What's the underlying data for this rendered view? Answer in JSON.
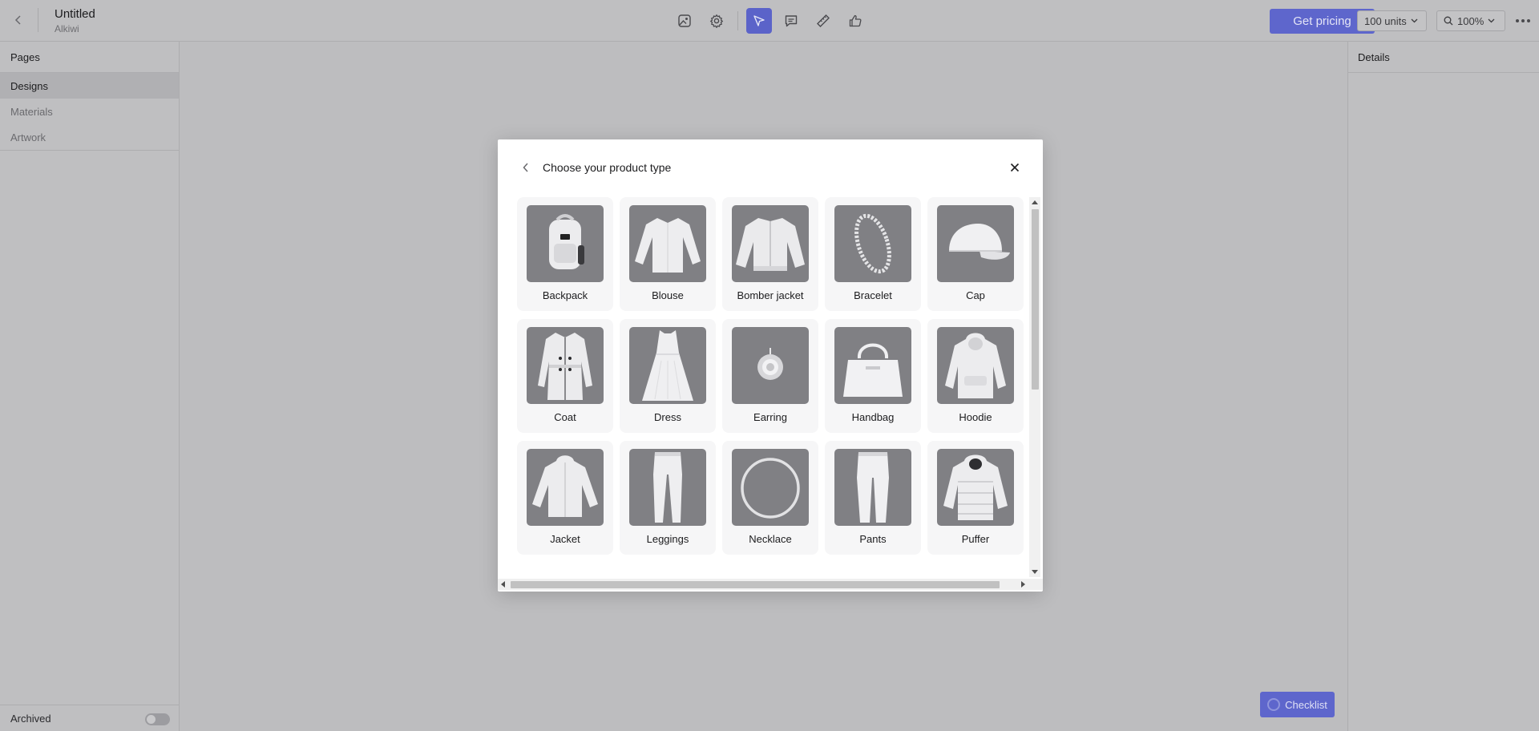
{
  "header": {
    "title": "Untitled",
    "subtitle": "Alkiwi",
    "back_icon": "chevron-left-icon",
    "tools": [
      {
        "name": "image-tool",
        "icon": "image-icon",
        "active": false
      },
      {
        "name": "settings-tool",
        "icon": "gear-icon",
        "active": false
      },
      {
        "name": "select-tool",
        "icon": "cursor-arrow-icon",
        "active": true
      },
      {
        "name": "comment-tool",
        "icon": "comment-icon",
        "active": false
      },
      {
        "name": "measure-tool",
        "icon": "ruler-icon",
        "active": false
      },
      {
        "name": "approve-tool",
        "icon": "thumbs-up-icon",
        "active": false
      }
    ],
    "pricing_label": "Get pricing",
    "units_label": "100 units",
    "zoom_label": "100%",
    "more_icon": "more-horizontal-icon"
  },
  "left_panel": {
    "heading": "Pages",
    "items": [
      {
        "label": "Designs",
        "active": true
      },
      {
        "label": "Materials",
        "active": false
      },
      {
        "label": "Artwork",
        "active": false
      }
    ],
    "archived_label": "Archived",
    "archived_on": false
  },
  "right_panel": {
    "heading": "Details"
  },
  "checklist_label": "Checklist",
  "modal": {
    "title": "Choose your product type",
    "back_icon": "chevron-left-icon",
    "close_icon": "close-icon",
    "products": [
      {
        "label": "Backpack",
        "icon": "backpack-icon"
      },
      {
        "label": "Blouse",
        "icon": "blouse-icon"
      },
      {
        "label": "Bomber jacket",
        "icon": "bomber-jacket-icon"
      },
      {
        "label": "Bracelet",
        "icon": "bracelet-icon"
      },
      {
        "label": "Cap",
        "icon": "cap-icon"
      },
      {
        "label": "Coat",
        "icon": "coat-icon"
      },
      {
        "label": "Dress",
        "icon": "dress-icon"
      },
      {
        "label": "Earring",
        "icon": "earring-icon"
      },
      {
        "label": "Handbag",
        "icon": "handbag-icon"
      },
      {
        "label": "Hoodie",
        "icon": "hoodie-icon"
      },
      {
        "label": "Jacket",
        "icon": "jacket-icon"
      },
      {
        "label": "Leggings",
        "icon": "leggings-icon"
      },
      {
        "label": "Necklace",
        "icon": "necklace-icon"
      },
      {
        "label": "Pants",
        "icon": "pants-icon"
      },
      {
        "label": "Puffer",
        "icon": "puffer-icon"
      }
    ]
  },
  "colors": {
    "accent": "#5e66cc",
    "overlay_bg": "#bdbdbf",
    "modal_bg": "#ffffff",
    "card_bg": "#f6f6f7",
    "thumb_bg": "#808084"
  }
}
